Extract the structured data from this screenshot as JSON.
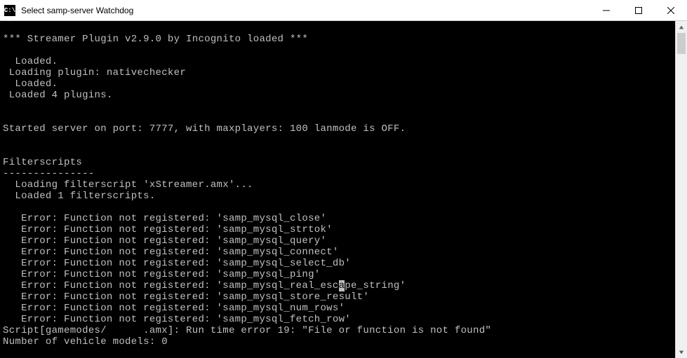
{
  "window": {
    "title": "Select samp-server Watchdog",
    "icon_label": "C:\\"
  },
  "console": {
    "lines": [
      "",
      "*** Streamer Plugin v2.9.0 by Incognito loaded ***",
      "",
      "  Loaded.",
      " Loading plugin: nativechecker",
      "  Loaded.",
      " Loaded 4 plugins.",
      "",
      "",
      "Started server on port: 7777, with maxplayers: 100 lanmode is OFF.",
      "",
      "",
      "Filterscripts",
      "---------------",
      "  Loading filterscript 'xStreamer.amx'...",
      "  Loaded 1 filterscripts.",
      "",
      "   Error: Function not registered: 'samp_mysql_close'",
      "   Error: Function not registered: 'samp_mysql_strtok'",
      "   Error: Function not registered: 'samp_mysql_query'",
      "   Error: Function not registered: 'samp_mysql_connect'",
      "   Error: Function not registered: 'samp_mysql_select_db'",
      "   Error: Function not registered: 'samp_mysql_ping'",
      "   Error: Function not registered: 'samp_mysql_real_escape_string'",
      "   Error: Function not registered: 'samp_mysql_store_result'",
      "   Error: Function not registered: 'samp_mysql_num_rows'",
      "   Error: Function not registered: 'samp_mysql_fetch_row'",
      "Script[gamemodes/      .amx]: Run time error 19: \"File or function is not found\"",
      "Number of vehicle models: 0"
    ],
    "cursor": {
      "line": 23,
      "col": 55
    }
  }
}
